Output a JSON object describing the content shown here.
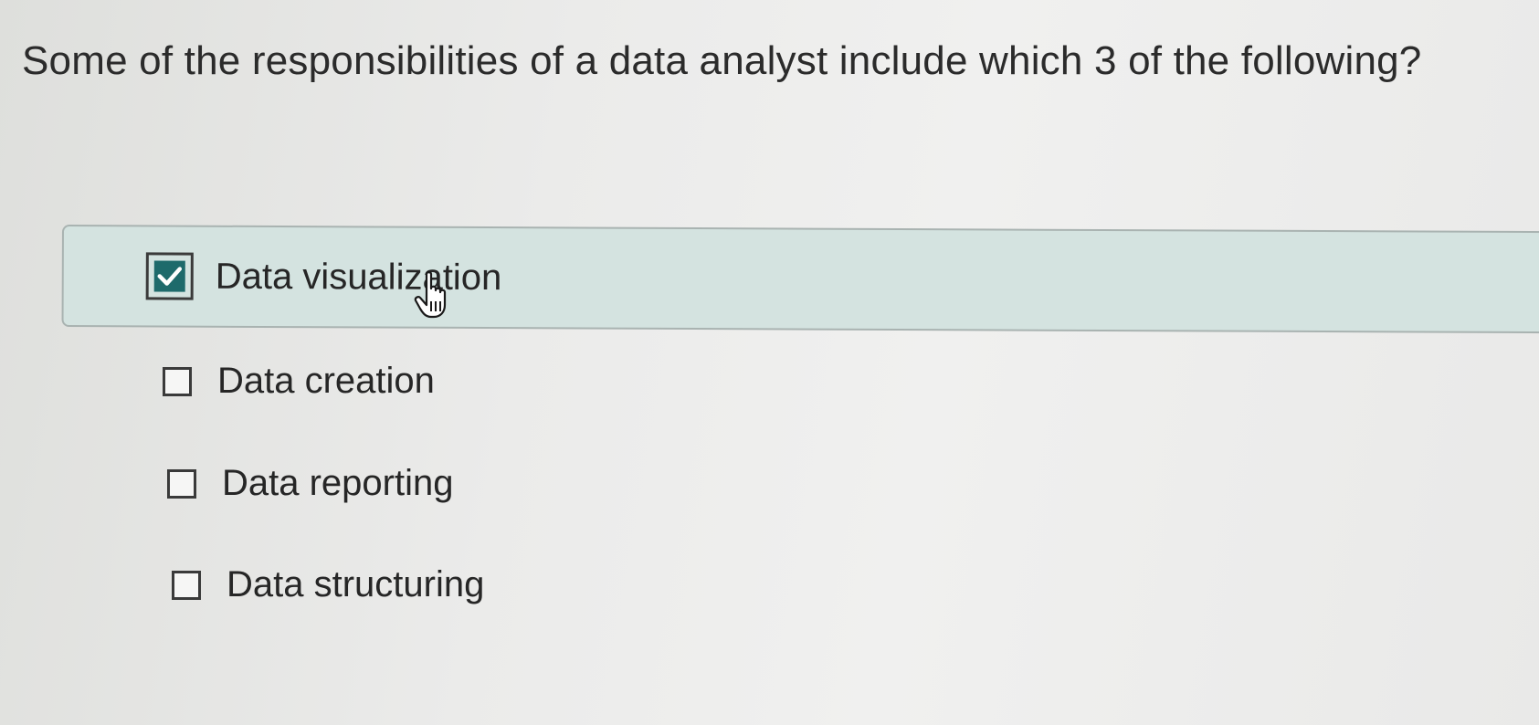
{
  "question": {
    "text": "Some of the responsibilities of a data analyst include which 3 of the following?"
  },
  "options": [
    {
      "label": "Data visualization",
      "checked": true
    },
    {
      "label": "Data creation",
      "checked": false
    },
    {
      "label": "Data reporting",
      "checked": false
    },
    {
      "label": "Data structuring",
      "checked": false
    }
  ],
  "colors": {
    "selected_background": "#d4e3e0",
    "checkbox_checked": "#1e6a6b",
    "text": "#2b2b2b"
  },
  "icons": {
    "check": "check-icon",
    "cursor": "hand-pointer-icon"
  }
}
